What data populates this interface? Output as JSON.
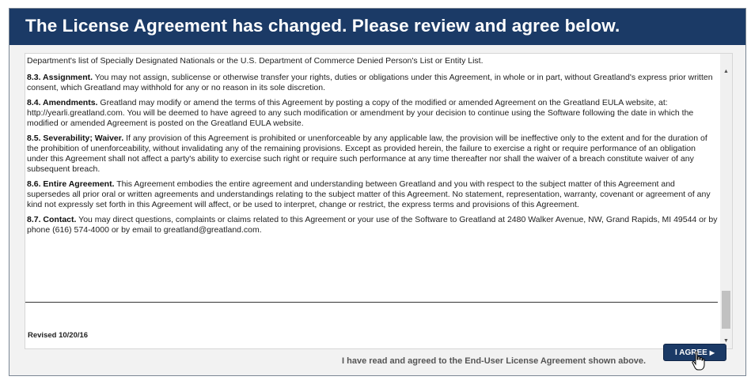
{
  "header": {
    "title": "The License Agreement has changed. Please review and agree below."
  },
  "agreement": {
    "lead_line": "Department's list of Specially Designated Nationals or the U.S. Department of Commerce Denied Person's List or Entity List.",
    "sections": [
      {
        "heading": "8.3.   Assignment.",
        "body": " You may not assign, sublicense or otherwise transfer your rights, duties or obligations under this Agreement, in whole or in part, without Greatland's express prior written consent, which Greatland may withhold for any or no reason in its sole discretion."
      },
      {
        "heading": "8.4.   Amendments.",
        "body": " Greatland may modify or amend the terms of this Agreement by posting a copy of the modified or amended Agreement on the Greatland EULA website, at: http://yearli.greatland.com. You will be deemed to have agreed to any such modification or amendment by your decision to continue using the Software following the date in which the modified or amended Agreement is posted on the Greatland EULA website."
      },
      {
        "heading": "8.5.   Severability; Waiver.",
        "body": " If any provision of this Agreement is prohibited or unenforceable by any applicable law, the provision will be ineffective only to the extent and for the duration of the prohibition of unenforceability, without invalidating any of the remaining provisions. Except as provided herein, the failure to exercise a right or require performance of an obligation under this Agreement shall not affect a party's ability to exercise such right or require such performance at any time thereafter nor shall the waiver of a breach constitute waiver of any subsequent breach."
      },
      {
        "heading": "8.6.   Entire Agreement.",
        "body": " This Agreement embodies the entire agreement and understanding between Greatland and you with respect to the subject matter of this Agreement and supersedes all prior oral or written agreements and understandings relating to the subject matter of this Agreement. No statement, representation, warranty, covenant or agreement of any kind not expressly set forth in this Agreement will affect, or be used to interpret, change or restrict, the express terms and provisions of this Agreement."
      },
      {
        "heading": "8.7.   Contact.",
        "body": "  You may direct questions, complaints or claims related to this Agreement or your use of the Software to Greatland at 2480 Walker Avenue, NW, Grand Rapids, MI 49544 or by phone (616) 574-4000 or by email to greatland@greatland.com."
      }
    ],
    "revised": "Revised 10/20/16"
  },
  "footer": {
    "statement": "I have read and agreed to the End-User License Agreement shown above.",
    "agree_label": "I AGREE"
  },
  "icons": {
    "scroll_up": "scroll-up-arrow-icon",
    "scroll_down": "scroll-down-arrow-icon",
    "agree_arrow": "play-arrow-icon",
    "cursor": "hand-pointer-icon"
  },
  "colors": {
    "header_bg": "#1b3a66",
    "button_bg": "#1b3a66",
    "dialog_bg": "#f2f2f2"
  }
}
